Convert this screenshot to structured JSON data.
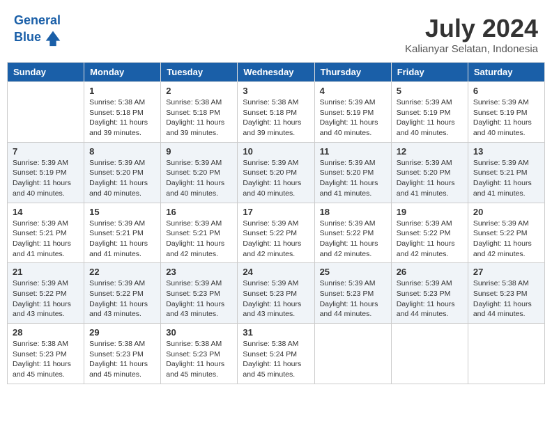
{
  "header": {
    "logo_line1": "General",
    "logo_line2": "Blue",
    "month_year": "July 2024",
    "location": "Kalianyar Selatan, Indonesia"
  },
  "weekdays": [
    "Sunday",
    "Monday",
    "Tuesday",
    "Wednesday",
    "Thursday",
    "Friday",
    "Saturday"
  ],
  "weeks": [
    [
      {
        "day": "",
        "info": ""
      },
      {
        "day": "1",
        "info": "Sunrise: 5:38 AM\nSunset: 5:18 PM\nDaylight: 11 hours\nand 39 minutes."
      },
      {
        "day": "2",
        "info": "Sunrise: 5:38 AM\nSunset: 5:18 PM\nDaylight: 11 hours\nand 39 minutes."
      },
      {
        "day": "3",
        "info": "Sunrise: 5:38 AM\nSunset: 5:18 PM\nDaylight: 11 hours\nand 39 minutes."
      },
      {
        "day": "4",
        "info": "Sunrise: 5:39 AM\nSunset: 5:19 PM\nDaylight: 11 hours\nand 40 minutes."
      },
      {
        "day": "5",
        "info": "Sunrise: 5:39 AM\nSunset: 5:19 PM\nDaylight: 11 hours\nand 40 minutes."
      },
      {
        "day": "6",
        "info": "Sunrise: 5:39 AM\nSunset: 5:19 PM\nDaylight: 11 hours\nand 40 minutes."
      }
    ],
    [
      {
        "day": "7",
        "info": "Sunrise: 5:39 AM\nSunset: 5:19 PM\nDaylight: 11 hours\nand 40 minutes."
      },
      {
        "day": "8",
        "info": "Sunrise: 5:39 AM\nSunset: 5:20 PM\nDaylight: 11 hours\nand 40 minutes."
      },
      {
        "day": "9",
        "info": "Sunrise: 5:39 AM\nSunset: 5:20 PM\nDaylight: 11 hours\nand 40 minutes."
      },
      {
        "day": "10",
        "info": "Sunrise: 5:39 AM\nSunset: 5:20 PM\nDaylight: 11 hours\nand 40 minutes."
      },
      {
        "day": "11",
        "info": "Sunrise: 5:39 AM\nSunset: 5:20 PM\nDaylight: 11 hours\nand 41 minutes."
      },
      {
        "day": "12",
        "info": "Sunrise: 5:39 AM\nSunset: 5:20 PM\nDaylight: 11 hours\nand 41 minutes."
      },
      {
        "day": "13",
        "info": "Sunrise: 5:39 AM\nSunset: 5:21 PM\nDaylight: 11 hours\nand 41 minutes."
      }
    ],
    [
      {
        "day": "14",
        "info": "Sunrise: 5:39 AM\nSunset: 5:21 PM\nDaylight: 11 hours\nand 41 minutes."
      },
      {
        "day": "15",
        "info": "Sunrise: 5:39 AM\nSunset: 5:21 PM\nDaylight: 11 hours\nand 41 minutes."
      },
      {
        "day": "16",
        "info": "Sunrise: 5:39 AM\nSunset: 5:21 PM\nDaylight: 11 hours\nand 42 minutes."
      },
      {
        "day": "17",
        "info": "Sunrise: 5:39 AM\nSunset: 5:22 PM\nDaylight: 11 hours\nand 42 minutes."
      },
      {
        "day": "18",
        "info": "Sunrise: 5:39 AM\nSunset: 5:22 PM\nDaylight: 11 hours\nand 42 minutes."
      },
      {
        "day": "19",
        "info": "Sunrise: 5:39 AM\nSunset: 5:22 PM\nDaylight: 11 hours\nand 42 minutes."
      },
      {
        "day": "20",
        "info": "Sunrise: 5:39 AM\nSunset: 5:22 PM\nDaylight: 11 hours\nand 42 minutes."
      }
    ],
    [
      {
        "day": "21",
        "info": "Sunrise: 5:39 AM\nSunset: 5:22 PM\nDaylight: 11 hours\nand 43 minutes."
      },
      {
        "day": "22",
        "info": "Sunrise: 5:39 AM\nSunset: 5:22 PM\nDaylight: 11 hours\nand 43 minutes."
      },
      {
        "day": "23",
        "info": "Sunrise: 5:39 AM\nSunset: 5:23 PM\nDaylight: 11 hours\nand 43 minutes."
      },
      {
        "day": "24",
        "info": "Sunrise: 5:39 AM\nSunset: 5:23 PM\nDaylight: 11 hours\nand 43 minutes."
      },
      {
        "day": "25",
        "info": "Sunrise: 5:39 AM\nSunset: 5:23 PM\nDaylight: 11 hours\nand 44 minutes."
      },
      {
        "day": "26",
        "info": "Sunrise: 5:39 AM\nSunset: 5:23 PM\nDaylight: 11 hours\nand 44 minutes."
      },
      {
        "day": "27",
        "info": "Sunrise: 5:38 AM\nSunset: 5:23 PM\nDaylight: 11 hours\nand 44 minutes."
      }
    ],
    [
      {
        "day": "28",
        "info": "Sunrise: 5:38 AM\nSunset: 5:23 PM\nDaylight: 11 hours\nand 45 minutes."
      },
      {
        "day": "29",
        "info": "Sunrise: 5:38 AM\nSunset: 5:23 PM\nDaylight: 11 hours\nand 45 minutes."
      },
      {
        "day": "30",
        "info": "Sunrise: 5:38 AM\nSunset: 5:23 PM\nDaylight: 11 hours\nand 45 minutes."
      },
      {
        "day": "31",
        "info": "Sunrise: 5:38 AM\nSunset: 5:24 PM\nDaylight: 11 hours\nand 45 minutes."
      },
      {
        "day": "",
        "info": ""
      },
      {
        "day": "",
        "info": ""
      },
      {
        "day": "",
        "info": ""
      }
    ]
  ]
}
